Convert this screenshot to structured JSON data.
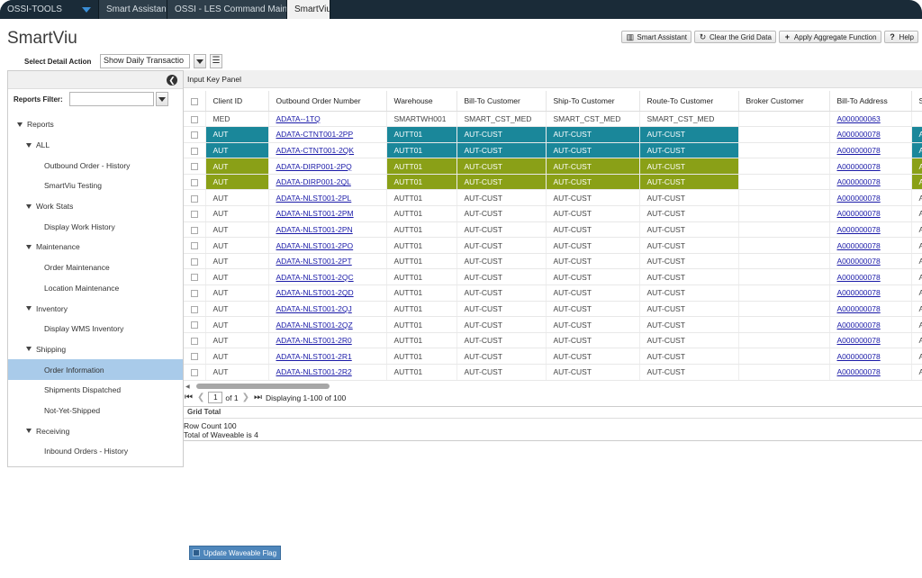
{
  "tabs": [
    {
      "label": "OSSI-TOOLS",
      "active": false
    },
    {
      "label": "Smart Assistant",
      "active": false
    },
    {
      "label": "OSSI - LES Command Mainten...",
      "active": false
    },
    {
      "label": "SmartViu",
      "active": true
    }
  ],
  "app_title": "SmartViu",
  "toolbar": {
    "smart_assistant": "Smart Assistant",
    "clear_grid": "Clear the Grid Data",
    "apply_aggregate": "Apply Aggregate Function",
    "help": "Help"
  },
  "select_detail_action": {
    "label": "Select Detail Action",
    "value": "Show Daily Transactio"
  },
  "reports_filter": {
    "label": "Reports Filter:",
    "value": ""
  },
  "tree": [
    {
      "label": "Reports",
      "level": "l0",
      "type": "folder"
    },
    {
      "label": "ALL",
      "level": "l1",
      "type": "folder"
    },
    {
      "label": "Outbound Order - History",
      "level": "leaf",
      "type": "leaf"
    },
    {
      "label": "SmartViu Testing",
      "level": "leaf",
      "type": "leaf"
    },
    {
      "label": "Work Stats",
      "level": "l1",
      "type": "folder"
    },
    {
      "label": "Display Work History",
      "level": "leaf",
      "type": "leaf"
    },
    {
      "label": "Maintenance",
      "level": "l1",
      "type": "folder"
    },
    {
      "label": "Order Maintenance",
      "level": "leaf",
      "type": "leaf"
    },
    {
      "label": "Location Maintenance",
      "level": "leaf",
      "type": "leaf"
    },
    {
      "label": "Inventory",
      "level": "l1",
      "type": "folder"
    },
    {
      "label": "Display WMS Inventory",
      "level": "leaf",
      "type": "leaf"
    },
    {
      "label": "Shipping",
      "level": "l1",
      "type": "folder"
    },
    {
      "label": "Order Information",
      "level": "leaf",
      "type": "leaf",
      "selected": true
    },
    {
      "label": "Shipments Dispatched",
      "level": "leaf",
      "type": "leaf"
    },
    {
      "label": "Not-Yet-Shipped",
      "level": "leaf",
      "type": "leaf"
    },
    {
      "label": "Receiving",
      "level": "l1",
      "type": "folder"
    },
    {
      "label": "Inbound Orders - History",
      "level": "leaf",
      "type": "leaf"
    }
  ],
  "input_key_panel": "Input Key Panel",
  "grid": {
    "columns": [
      "Client ID",
      "Outbound Order Number",
      "Warehouse",
      "Bill-To Customer",
      "Ship-To Customer",
      "Route-To Customer",
      "Broker Customer",
      "Bill-To Address",
      "S"
    ],
    "rows": [
      {
        "client": "MED",
        "order": "ADATA--1TQ",
        "wh": "SMARTWH001",
        "bill": "SMART_CST_MED",
        "ship": "SMART_CST_MED",
        "route": "SMART_CST_MED",
        "broker": "",
        "addr": "A000000063",
        "last": "",
        "hl": ""
      },
      {
        "client": "AUT",
        "order": "ADATA-CTNT001-2PP",
        "wh": "AUTT01",
        "bill": "AUT-CUST",
        "ship": "AUT-CUST",
        "route": "AUT-CUST",
        "broker": "",
        "addr": "A000000078",
        "last": "A",
        "hl": "teal"
      },
      {
        "client": "AUT",
        "order": "ADATA-CTNT001-2QK",
        "wh": "AUTT01",
        "bill": "AUT-CUST",
        "ship": "AUT-CUST",
        "route": "AUT-CUST",
        "broker": "",
        "addr": "A000000078",
        "last": "A",
        "hl": "teal"
      },
      {
        "client": "AUT",
        "order": "ADATA-DIRP001-2PQ",
        "wh": "AUTT01",
        "bill": "AUT-CUST",
        "ship": "AUT-CUST",
        "route": "AUT-CUST",
        "broker": "",
        "addr": "A000000078",
        "last": "A",
        "hl": "olive"
      },
      {
        "client": "AUT",
        "order": "ADATA-DIRP001-2QL",
        "wh": "AUTT01",
        "bill": "AUT-CUST",
        "ship": "AUT-CUST",
        "route": "AUT-CUST",
        "broker": "",
        "addr": "A000000078",
        "last": "A",
        "hl": "olive"
      },
      {
        "client": "AUT",
        "order": "ADATA-NLST001-2PL",
        "wh": "AUTT01",
        "bill": "AUT-CUST",
        "ship": "AUT-CUST",
        "route": "AUT-CUST",
        "broker": "",
        "addr": "A000000078",
        "last": "A",
        "hl": ""
      },
      {
        "client": "AUT",
        "order": "ADATA-NLST001-2PM",
        "wh": "AUTT01",
        "bill": "AUT-CUST",
        "ship": "AUT-CUST",
        "route": "AUT-CUST",
        "broker": "",
        "addr": "A000000078",
        "last": "A",
        "hl": ""
      },
      {
        "client": "AUT",
        "order": "ADATA-NLST001-2PN",
        "wh": "AUTT01",
        "bill": "AUT-CUST",
        "ship": "AUT-CUST",
        "route": "AUT-CUST",
        "broker": "",
        "addr": "A000000078",
        "last": "A",
        "hl": ""
      },
      {
        "client": "AUT",
        "order": "ADATA-NLST001-2PO",
        "wh": "AUTT01",
        "bill": "AUT-CUST",
        "ship": "AUT-CUST",
        "route": "AUT-CUST",
        "broker": "",
        "addr": "A000000078",
        "last": "A",
        "hl": ""
      },
      {
        "client": "AUT",
        "order": "ADATA-NLST001-2PT",
        "wh": "AUTT01",
        "bill": "AUT-CUST",
        "ship": "AUT-CUST",
        "route": "AUT-CUST",
        "broker": "",
        "addr": "A000000078",
        "last": "A",
        "hl": ""
      },
      {
        "client": "AUT",
        "order": "ADATA-NLST001-2QC",
        "wh": "AUTT01",
        "bill": "AUT-CUST",
        "ship": "AUT-CUST",
        "route": "AUT-CUST",
        "broker": "",
        "addr": "A000000078",
        "last": "A",
        "hl": ""
      },
      {
        "client": "AUT",
        "order": "ADATA-NLST001-2QD",
        "wh": "AUTT01",
        "bill": "AUT-CUST",
        "ship": "AUT-CUST",
        "route": "AUT-CUST",
        "broker": "",
        "addr": "A000000078",
        "last": "A",
        "hl": ""
      },
      {
        "client": "AUT",
        "order": "ADATA-NLST001-2QJ",
        "wh": "AUTT01",
        "bill": "AUT-CUST",
        "ship": "AUT-CUST",
        "route": "AUT-CUST",
        "broker": "",
        "addr": "A000000078",
        "last": "A",
        "hl": ""
      },
      {
        "client": "AUT",
        "order": "ADATA-NLST001-2QZ",
        "wh": "AUTT01",
        "bill": "AUT-CUST",
        "ship": "AUT-CUST",
        "route": "AUT-CUST",
        "broker": "",
        "addr": "A000000078",
        "last": "A",
        "hl": ""
      },
      {
        "client": "AUT",
        "order": "ADATA-NLST001-2R0",
        "wh": "AUTT01",
        "bill": "AUT-CUST",
        "ship": "AUT-CUST",
        "route": "AUT-CUST",
        "broker": "",
        "addr": "A000000078",
        "last": "A",
        "hl": ""
      },
      {
        "client": "AUT",
        "order": "ADATA-NLST001-2R1",
        "wh": "AUTT01",
        "bill": "AUT-CUST",
        "ship": "AUT-CUST",
        "route": "AUT-CUST",
        "broker": "",
        "addr": "A000000078",
        "last": "A",
        "hl": ""
      },
      {
        "client": "AUT",
        "order": "ADATA-NLST001-2R2",
        "wh": "AUTT01",
        "bill": "AUT-CUST",
        "ship": "AUT-CUST",
        "route": "AUT-CUST",
        "broker": "",
        "addr": "A000000078",
        "last": "A",
        "hl": ""
      }
    ]
  },
  "pager": {
    "page": "1",
    "of": "of 1",
    "display": "Displaying 1-100 of 100"
  },
  "grid_total": {
    "title": "Grid Total",
    "row_count": "Row Count 100",
    "waveable": "Total of Waveable is 4"
  },
  "update_button": "Update Waveable Flag",
  "colors": {
    "tabbar": "#1a2b38",
    "teal": "#1a879a",
    "olive": "#8aa017",
    "selected_node": "#a9cbea",
    "button": "#4e86bb"
  }
}
